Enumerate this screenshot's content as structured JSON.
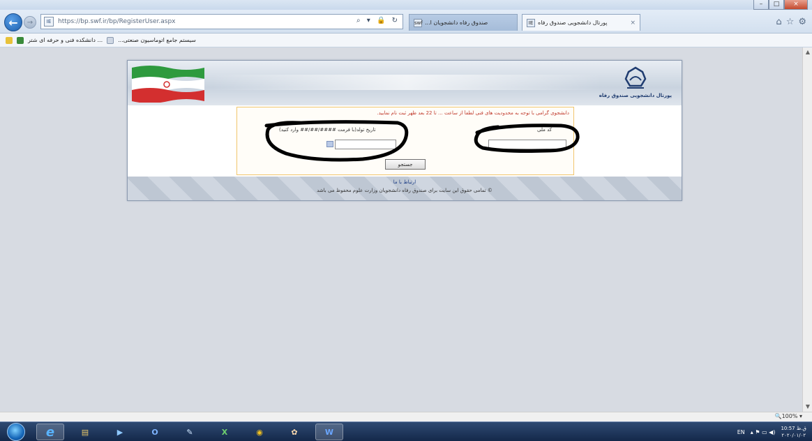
{
  "browser": {
    "url": "https://bp.swf.ir/bp/RegisterUser.aspx",
    "site_icon": "IE",
    "address_tools": "⌕ ▾ 🔒 ↻",
    "tabs": [
      {
        "label": "...صندوق رفاه دانشجویان ا",
        "icon": "swf"
      },
      {
        "label": "پورتال دانشجویی صندوق رفاه",
        "icon": "IE",
        "close": "×"
      }
    ],
    "favorites": [
      {
        "label": "دانشکده فنی و حرفه ای شتر ..."
      },
      {
        "label": "...سیستم جامع اتوماسیون صنعتی"
      }
    ],
    "window_controls": {
      "min": "–",
      "max": "□",
      "close": "×"
    },
    "right_icons": [
      "⌂",
      "☆",
      "⚙"
    ]
  },
  "portal": {
    "title": "پورتال دانشجویی صندوق رفاه",
    "form": {
      "notice": "دانشجوی گرامی با توجه به محدودیت های فنی لطفاً از ساعت ... تا 22 بعد ظهر ثبت نام نمایید.",
      "code_label": "کد ملی",
      "birth_label": "تاریخ تولد(با فرمت ####/##/## وارد کنید)",
      "search_button": "جستجو"
    },
    "footer": {
      "contact": "ارتباط با ما",
      "copyright": "© تمامی حقوق این سایت برای صندوق رفاه دانشجویان وزارت علوم محفوظ می باشد"
    }
  },
  "status": {
    "zoom": "🔍100% ▾"
  },
  "taskbar": {
    "apps": [
      {
        "name": "ie",
        "glyph": "e"
      },
      {
        "name": "explorer",
        "glyph": "▤"
      },
      {
        "name": "media",
        "glyph": "▶"
      },
      {
        "name": "outlook",
        "glyph": "O"
      },
      {
        "name": "network",
        "glyph": "✎"
      },
      {
        "name": "excel",
        "glyph": "X"
      },
      {
        "name": "chrome",
        "glyph": "◉"
      },
      {
        "name": "paint",
        "glyph": "✿"
      },
      {
        "name": "word",
        "glyph": "W"
      }
    ],
    "lang": "EN",
    "tray_icons": "▴ ⚑ ▭ ◀)",
    "time": "10:57 ق.ظ",
    "date": "۲۰۲۰/۰۱/۰۲"
  }
}
